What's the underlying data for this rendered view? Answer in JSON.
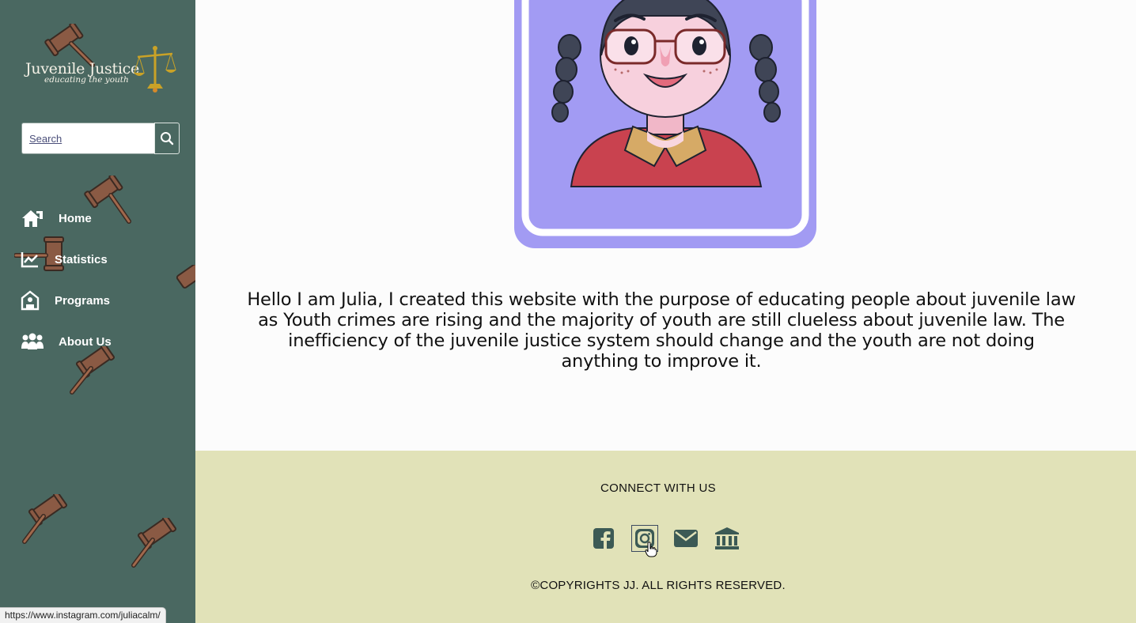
{
  "sidebar": {
    "logo": {
      "title": "Juvenile Justice",
      "subtitle": "educating the youth"
    },
    "search": {
      "placeholder": "Search",
      "button_icon": "search-icon"
    },
    "nav": [
      {
        "label": "Home",
        "icon": "home-icon"
      },
      {
        "label": "Statistics",
        "icon": "chart-line-icon"
      },
      {
        "label": "Programs",
        "icon": "school-icon"
      },
      {
        "label": "About Us",
        "icon": "users-icon"
      }
    ],
    "background_color": "#4a6861"
  },
  "main": {
    "bio": "Hello I am Julia, I created this website with the purpose of educating people about juvenile law as Youth crimes are rising and the majority of youth are still clueless about juvenile law. The inefficiency of the juvenile justice system should change and the youth are not doing anything to improve it."
  },
  "footer": {
    "connect_label": "CONNECT WITH US",
    "social": [
      {
        "icon": "facebook-icon"
      },
      {
        "icon": "instagram-icon"
      },
      {
        "icon": "envelope-icon"
      },
      {
        "icon": "landmark-icon"
      }
    ],
    "copyright": "©COPYRIGHTS JJ. ALL RIGHTS RESERVED.",
    "background_color": "#e1e2b8"
  },
  "status_bar": {
    "url": "https://www.instagram.com/juliacalm/"
  }
}
